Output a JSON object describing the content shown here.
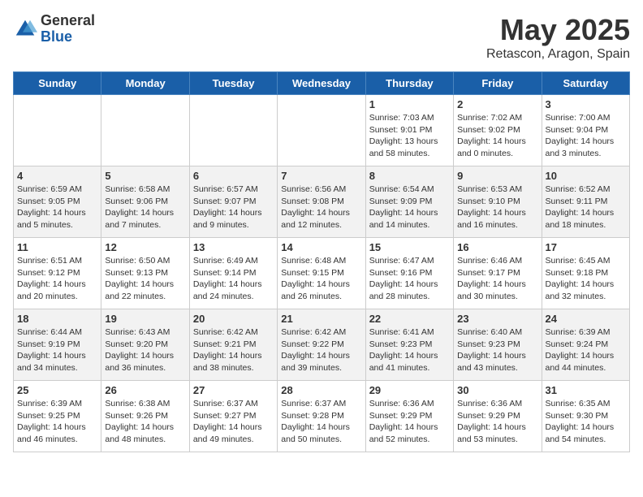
{
  "logo": {
    "general": "General",
    "blue": "Blue"
  },
  "title": "May 2025",
  "location": "Retascon, Aragon, Spain",
  "days_of_week": [
    "Sunday",
    "Monday",
    "Tuesday",
    "Wednesday",
    "Thursday",
    "Friday",
    "Saturday"
  ],
  "weeks": [
    [
      {
        "day": "",
        "info": ""
      },
      {
        "day": "",
        "info": ""
      },
      {
        "day": "",
        "info": ""
      },
      {
        "day": "",
        "info": ""
      },
      {
        "day": "1",
        "info": "Sunrise: 7:03 AM\nSunset: 9:01 PM\nDaylight: 13 hours\nand 58 minutes."
      },
      {
        "day": "2",
        "info": "Sunrise: 7:02 AM\nSunset: 9:02 PM\nDaylight: 14 hours\nand 0 minutes."
      },
      {
        "day": "3",
        "info": "Sunrise: 7:00 AM\nSunset: 9:04 PM\nDaylight: 14 hours\nand 3 minutes."
      }
    ],
    [
      {
        "day": "4",
        "info": "Sunrise: 6:59 AM\nSunset: 9:05 PM\nDaylight: 14 hours\nand 5 minutes."
      },
      {
        "day": "5",
        "info": "Sunrise: 6:58 AM\nSunset: 9:06 PM\nDaylight: 14 hours\nand 7 minutes."
      },
      {
        "day": "6",
        "info": "Sunrise: 6:57 AM\nSunset: 9:07 PM\nDaylight: 14 hours\nand 9 minutes."
      },
      {
        "day": "7",
        "info": "Sunrise: 6:56 AM\nSunset: 9:08 PM\nDaylight: 14 hours\nand 12 minutes."
      },
      {
        "day": "8",
        "info": "Sunrise: 6:54 AM\nSunset: 9:09 PM\nDaylight: 14 hours\nand 14 minutes."
      },
      {
        "day": "9",
        "info": "Sunrise: 6:53 AM\nSunset: 9:10 PM\nDaylight: 14 hours\nand 16 minutes."
      },
      {
        "day": "10",
        "info": "Sunrise: 6:52 AM\nSunset: 9:11 PM\nDaylight: 14 hours\nand 18 minutes."
      }
    ],
    [
      {
        "day": "11",
        "info": "Sunrise: 6:51 AM\nSunset: 9:12 PM\nDaylight: 14 hours\nand 20 minutes."
      },
      {
        "day": "12",
        "info": "Sunrise: 6:50 AM\nSunset: 9:13 PM\nDaylight: 14 hours\nand 22 minutes."
      },
      {
        "day": "13",
        "info": "Sunrise: 6:49 AM\nSunset: 9:14 PM\nDaylight: 14 hours\nand 24 minutes."
      },
      {
        "day": "14",
        "info": "Sunrise: 6:48 AM\nSunset: 9:15 PM\nDaylight: 14 hours\nand 26 minutes."
      },
      {
        "day": "15",
        "info": "Sunrise: 6:47 AM\nSunset: 9:16 PM\nDaylight: 14 hours\nand 28 minutes."
      },
      {
        "day": "16",
        "info": "Sunrise: 6:46 AM\nSunset: 9:17 PM\nDaylight: 14 hours\nand 30 minutes."
      },
      {
        "day": "17",
        "info": "Sunrise: 6:45 AM\nSunset: 9:18 PM\nDaylight: 14 hours\nand 32 minutes."
      }
    ],
    [
      {
        "day": "18",
        "info": "Sunrise: 6:44 AM\nSunset: 9:19 PM\nDaylight: 14 hours\nand 34 minutes."
      },
      {
        "day": "19",
        "info": "Sunrise: 6:43 AM\nSunset: 9:20 PM\nDaylight: 14 hours\nand 36 minutes."
      },
      {
        "day": "20",
        "info": "Sunrise: 6:42 AM\nSunset: 9:21 PM\nDaylight: 14 hours\nand 38 minutes."
      },
      {
        "day": "21",
        "info": "Sunrise: 6:42 AM\nSunset: 9:22 PM\nDaylight: 14 hours\nand 39 minutes."
      },
      {
        "day": "22",
        "info": "Sunrise: 6:41 AM\nSunset: 9:23 PM\nDaylight: 14 hours\nand 41 minutes."
      },
      {
        "day": "23",
        "info": "Sunrise: 6:40 AM\nSunset: 9:23 PM\nDaylight: 14 hours\nand 43 minutes."
      },
      {
        "day": "24",
        "info": "Sunrise: 6:39 AM\nSunset: 9:24 PM\nDaylight: 14 hours\nand 44 minutes."
      }
    ],
    [
      {
        "day": "25",
        "info": "Sunrise: 6:39 AM\nSunset: 9:25 PM\nDaylight: 14 hours\nand 46 minutes."
      },
      {
        "day": "26",
        "info": "Sunrise: 6:38 AM\nSunset: 9:26 PM\nDaylight: 14 hours\nand 48 minutes."
      },
      {
        "day": "27",
        "info": "Sunrise: 6:37 AM\nSunset: 9:27 PM\nDaylight: 14 hours\nand 49 minutes."
      },
      {
        "day": "28",
        "info": "Sunrise: 6:37 AM\nSunset: 9:28 PM\nDaylight: 14 hours\nand 50 minutes."
      },
      {
        "day": "29",
        "info": "Sunrise: 6:36 AM\nSunset: 9:29 PM\nDaylight: 14 hours\nand 52 minutes."
      },
      {
        "day": "30",
        "info": "Sunrise: 6:36 AM\nSunset: 9:29 PM\nDaylight: 14 hours\nand 53 minutes."
      },
      {
        "day": "31",
        "info": "Sunrise: 6:35 AM\nSunset: 9:30 PM\nDaylight: 14 hours\nand 54 minutes."
      }
    ]
  ]
}
